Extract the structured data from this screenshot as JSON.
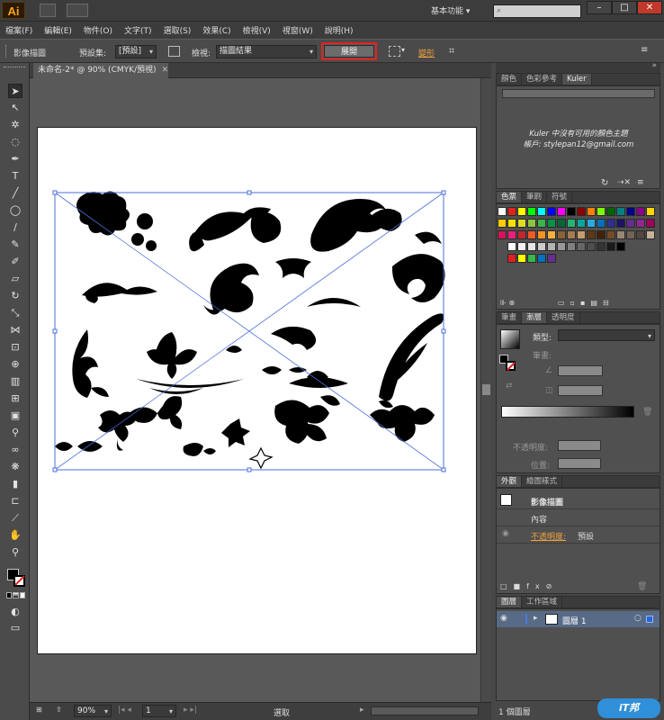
{
  "app": {
    "logo": "Ai"
  },
  "titlebar": {
    "workspace": "基本功能",
    "search_placeholder": ""
  },
  "menu": [
    "檔案(F)",
    "編輯(E)",
    "物件(O)",
    "文字(T)",
    "選取(S)",
    "效果(C)",
    "檢視(V)",
    "視窗(W)",
    "說明(H)"
  ],
  "control": {
    "object_label": "影像描圖",
    "preset_label": "預設集:",
    "preset_value": "[預設]",
    "view_label": "檢視:",
    "view_value": "描圖結果",
    "expand_button": "展開",
    "shape_label": "變形"
  },
  "document": {
    "tab": "未命名-2* @ 90% (CMYK/預視)"
  },
  "status": {
    "zoom": "90%",
    "page": "1",
    "tool": "選取"
  },
  "color_panel": {
    "tabs": [
      "顏色",
      "色彩參考",
      "Kuler"
    ],
    "message_line1": "Kuler 中沒有可用的顏色主題",
    "message_line2": "帳戶: stylepan12@gmail.com"
  },
  "swatches_panel": {
    "tabs": [
      "色票",
      "筆刷",
      "符號"
    ]
  },
  "stroke_panel": {
    "tabs": [
      "筆畫",
      "漸層",
      "透明度"
    ],
    "type_label": "類型:",
    "stroke_label": "筆畫:",
    "opacity_label": "不透明度:",
    "position_label": "位置:"
  },
  "appearance_panel": {
    "tabs": [
      "外觀",
      "繪圖樣式"
    ],
    "title": "影像描圖",
    "content": "內容",
    "opacity_label": "不透明度:",
    "opacity_value": "預設"
  },
  "layers_panel": {
    "tabs": [
      "圖層",
      "工作區域"
    ],
    "layer_name": "圖層 1",
    "count": "1 個圖層"
  },
  "colors": {
    "accent_red": "#e0221f",
    "layer_highlight": "#576a86",
    "ai_orange": "#f7a21b"
  }
}
